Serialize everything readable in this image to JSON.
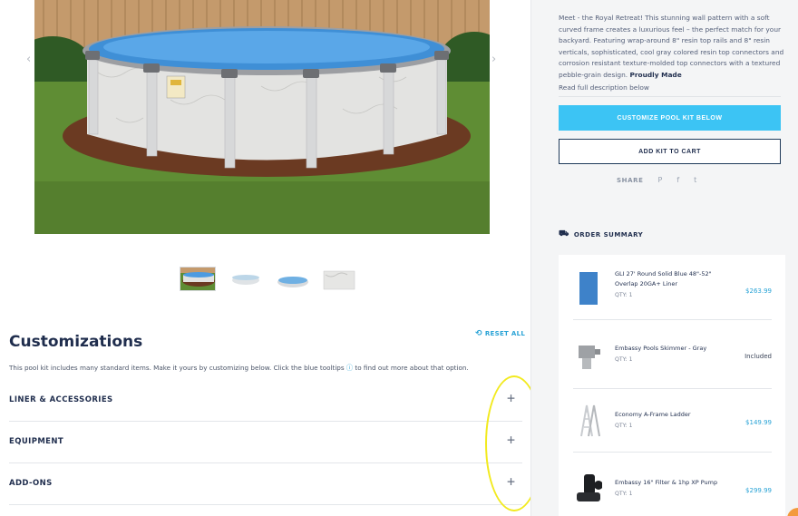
{
  "carousel": {
    "prev_glyph": "‹",
    "next_glyph": "›",
    "prev_icon": "chevron-left-icon",
    "next_icon": "chevron-right-icon"
  },
  "customizations": {
    "title": "Customizations",
    "reset_label": "RESET ALL",
    "reset_icon": "reset-icon",
    "description_before": "This pool kit includes many standard items. Make it yours by customizing below. Click the blue tooltips",
    "tooltip_glyph": "ⓘ",
    "description_after": "to find out more about that option.",
    "sections": [
      {
        "label": "LINER & ACCESSORIES",
        "toggle": "+"
      },
      {
        "label": "EQUIPMENT",
        "toggle": "+"
      },
      {
        "label": "ADD-ONS",
        "toggle": "+"
      }
    ]
  },
  "product": {
    "description_intro": "Meet - the Royal Retreat! This stunning wall pattern with a soft curved frame creates a luxurious feel – the perfect match for your backyard. Featuring wrap-around 8\" resin top rails and 8\" resin verticals, sophisticated, cool gray colored resin top connectors and corrosion resistant texture-molded top connectors with a textured pebble-grain design.",
    "description_bold": "Proudly Made",
    "read_more": "Read full description below",
    "customize_button": "CUSTOMIZE POOL KIT BELOW",
    "add_to_cart_button": "ADD KIT TO CART",
    "share_label": "SHARE",
    "share_icons": {
      "pinterest": "P",
      "facebook": "f",
      "twitter": "t"
    }
  },
  "order_summary": {
    "title": "ORDER SUMMARY",
    "icon": "truck-icon",
    "items": [
      {
        "name": "GLI 27' Round Solid Blue 48\"-52\" Overlap 20GA+ Liner",
        "qty": "QTY: 1",
        "price": "$263.99"
      },
      {
        "name": "Embassy Pools Skimmer - Gray",
        "qty": "QTY: 1",
        "price": "Included"
      },
      {
        "name": "Economy A-Frame Ladder",
        "qty": "QTY: 1",
        "price": "$149.99"
      },
      {
        "name": "Embassy 16\" Filter & 1hp XP Pump",
        "qty": "QTY: 1",
        "price": "$299.99"
      }
    ]
  },
  "colors": {
    "accent": "#3cc4f4",
    "link": "#29a3d6",
    "navy": "#1f2d4d",
    "highlight": "#f2ea1f"
  }
}
